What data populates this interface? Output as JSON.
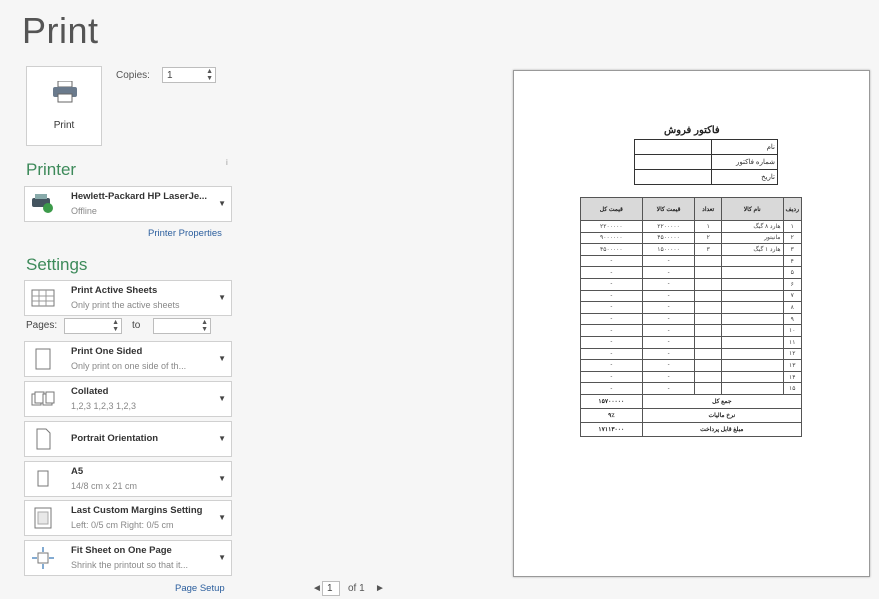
{
  "page": {
    "title": "Print"
  },
  "print_button": {
    "label": "Print"
  },
  "copies": {
    "label": "Copies:",
    "value": "1"
  },
  "printer": {
    "section_title": "Printer",
    "name": "Hewlett-Packard HP LaserJe...",
    "status": "Offline",
    "properties_link": "Printer Properties",
    "info_mark": "i"
  },
  "settings": {
    "section_title": "Settings",
    "items": [
      {
        "title": "Print Active Sheets",
        "sub": "Only print the active sheets",
        "icon": "sheets-icon"
      },
      {
        "title": "Print One Sided",
        "sub": "Only print on one side of th...",
        "icon": "one-sided-icon"
      },
      {
        "title": "Collated",
        "sub": "1,2,3   1,2,3   1,2,3",
        "icon": "collated-icon"
      },
      {
        "title": "Portrait Orientation",
        "sub": "",
        "icon": "portrait-icon"
      },
      {
        "title": "A5",
        "sub": "14/8 cm x 21 cm",
        "icon": "paper-size-icon"
      },
      {
        "title": "Last Custom Margins Setting",
        "sub": "Left: 0/5 cm    Right: 0/5 cm",
        "icon": "margins-icon"
      },
      {
        "title": "Fit Sheet on One Page",
        "sub": "Shrink the printout so that it...",
        "icon": "scaling-icon"
      }
    ],
    "pages_label": "Pages:",
    "pages_from": "",
    "to_label": "to",
    "pages_to": "",
    "page_setup_link": "Page Setup"
  },
  "navigation": {
    "prev": "◄",
    "current_page": "1",
    "of_label": "of 1",
    "next": "►"
  },
  "preview": {
    "sheet_title": "فاکتور فروش",
    "info_rows": [
      {
        "label": "نام",
        "value": ""
      },
      {
        "label": "شماره فاکتور",
        "value": ""
      },
      {
        "label": "تاریخ",
        "value": ""
      }
    ],
    "headers": [
      "ردیف",
      "نام کالا",
      "تعداد",
      "قیمت کالا",
      "قیمت کل"
    ],
    "rows": [
      {
        "n": "۱",
        "name": "هارد ۸ گیگ",
        "qty": "۱",
        "price": "۲۲۰۰۰۰۰",
        "total": "۲۲۰۰۰۰۰"
      },
      {
        "n": "۲",
        "name": "مانیتور",
        "qty": "۲",
        "price": "۴۵۰۰۰۰۰",
        "total": "۹۰۰۰۰۰۰"
      },
      {
        "n": "۳",
        "name": "هارد ۱ گیگ",
        "qty": "۳",
        "price": "۱۵۰۰۰۰۰",
        "total": "۴۵۰۰۰۰۰"
      },
      {
        "n": "۴",
        "name": "",
        "qty": "",
        "price": "-",
        "total": "-"
      },
      {
        "n": "۵",
        "name": "",
        "qty": "",
        "price": "-",
        "total": "-"
      },
      {
        "n": "۶",
        "name": "",
        "qty": "",
        "price": "-",
        "total": "-"
      },
      {
        "n": "۷",
        "name": "",
        "qty": "",
        "price": "-",
        "total": "-"
      },
      {
        "n": "۸",
        "name": "",
        "qty": "",
        "price": "-",
        "total": "-"
      },
      {
        "n": "۹",
        "name": "",
        "qty": "",
        "price": "-",
        "total": "-"
      },
      {
        "n": "۱۰",
        "name": "",
        "qty": "",
        "price": "-",
        "total": "-"
      },
      {
        "n": "۱۱",
        "name": "",
        "qty": "",
        "price": "-",
        "total": "-"
      },
      {
        "n": "۱۲",
        "name": "",
        "qty": "",
        "price": "-",
        "total": "-"
      },
      {
        "n": "۱۳",
        "name": "",
        "qty": "",
        "price": "-",
        "total": "-"
      },
      {
        "n": "۱۴",
        "name": "",
        "qty": "",
        "price": "-",
        "total": "-"
      },
      {
        "n": "۱۵",
        "name": "",
        "qty": "",
        "price": "-",
        "total": "-"
      }
    ],
    "summary": [
      {
        "label": "جمع کل",
        "value": "۱۵۷۰۰۰۰۰"
      },
      {
        "label": "نرخ مالیات",
        "value": "۹٪"
      },
      {
        "label": "مبلغ قابل پرداخت",
        "value": "۱۷۱۱۳۰۰۰"
      }
    ]
  },
  "colors": {
    "section_green": "#3d8a5a",
    "link_blue": "#2c5f9e"
  }
}
